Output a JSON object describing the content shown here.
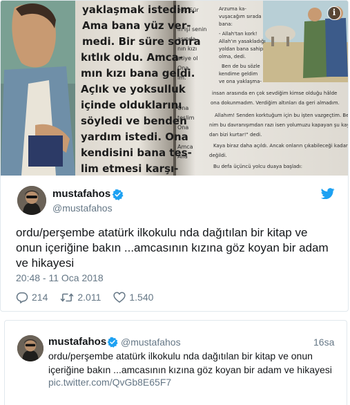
{
  "media": {
    "left_page_lines": [
      "yaklaşmak istedim.",
      "Ama bana yüz ver-",
      "medi. Bir süre sonra",
      "kıtlık oldu. Amca-",
      "mın kızı bana geldi.",
      "Açlık ve yoksulluk",
      "içinde olduklarını",
      "söyledi ve benden",
      "yardım istedi. Ona",
      "kendisini bana tes-",
      "lim etmesi karşı-"
    ],
    "right_page_lines": [
      "insan arasında en çok sevdiğim kimse olduğu hâlde",
      "ona dokunmadım. Verdiğim altınları da geri almadım.",
      "Allahım! Senden korktuğum için bu işten vazgeçtim. Be",
      "nim bu davranışımdan razı isen yolumuzu kapayan şu kaya",
      "dan bizi kurtar!\" dedi.",
      "Kaya biraz daha açıldı. Ancak onların çıkabileceği kadar",
      "değildi.",
      "Bu defa üçüncü yolcu duaya başladı:"
    ],
    "right_col_lines": [
      "Arzuma ka-",
      "vuşacağım sırada",
      "bana:",
      "- Allah'tan kork!",
      "Allah'ın yasakladığı",
      "yoldan bana sahip",
      "olma, dedi.",
      "Ben de bu sözle",
      "kendime geldim",
      "ve ona yaklaşma-"
    ],
    "info_icon": "info-icon"
  },
  "tweet": {
    "display_name": "mustafahos",
    "handle": "@mustafahos",
    "text": "ordu/perşembe atatürk ilkokulu nda dağıtılan bir kitap ve onun içeriğine bakın ...amcasının kızına göz koyan bir adam ve hikayesi",
    "timestamp": "20:48 - 11 Oca 2018",
    "replies": "214",
    "retweets": "2.011",
    "likes": "1.540"
  },
  "embedded_tweet": {
    "display_name": "mustafahos",
    "handle": "@mustafahos",
    "time": "16sa",
    "text": "ordu/perşembe atatürk ilkokulu nda dağıtılan bir kitap ve onun içeriğine bakın ...amcasının kızına göz koyan bir adam ve hikayesi",
    "link": "pic.twitter.com/QvGb8E65F7"
  },
  "colors": {
    "twitter_blue": "#1da1f2",
    "text": "#14171a",
    "secondary": "#657786",
    "border": "#e1e8ed"
  }
}
